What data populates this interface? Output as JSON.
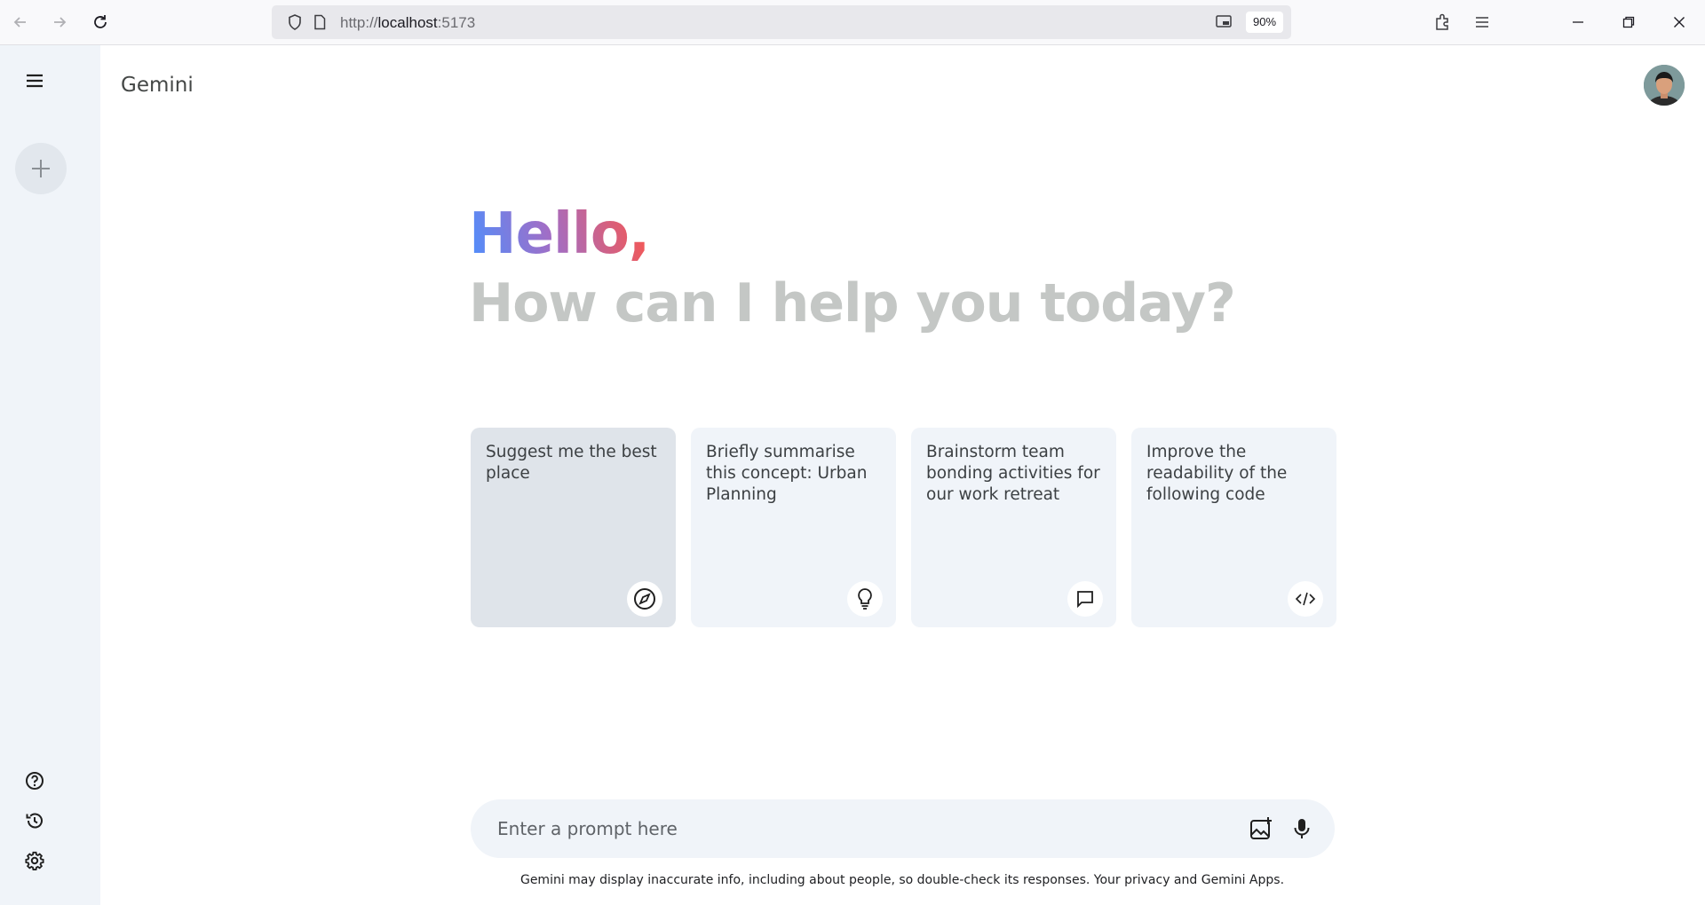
{
  "browser": {
    "url_prefix": "http://",
    "url_host": "localhost",
    "url_port": ":5173",
    "zoom": "90%"
  },
  "app": {
    "title": "Gemini"
  },
  "greeting": {
    "hello": "Hello,",
    "question": "How can I help you today?"
  },
  "cards": [
    {
      "text": "Suggest me the best place",
      "icon": "compass-icon"
    },
    {
      "text": "Briefly summarise this concept: Urban Planning",
      "icon": "lightbulb-icon"
    },
    {
      "text": "Brainstorm team bonding activities for our work retreat",
      "icon": "message-icon"
    },
    {
      "text": "Improve the readability of the following code",
      "icon": "code-icon"
    }
  ],
  "prompt": {
    "placeholder": "Enter a prompt here"
  },
  "disclaimer": "Gemini may display inaccurate info, including about people, so double-check its responses. Your privacy and Gemini Apps.",
  "colors": {
    "sidebar_bg": "#f0f4f9",
    "card_bg": "#f0f4f9",
    "card_active_bg": "#dfe4ea",
    "greeting_gradient": [
      "#4b90ff",
      "#a16ec6",
      "#ff5546"
    ],
    "subtitle": "#c4c7c5"
  }
}
